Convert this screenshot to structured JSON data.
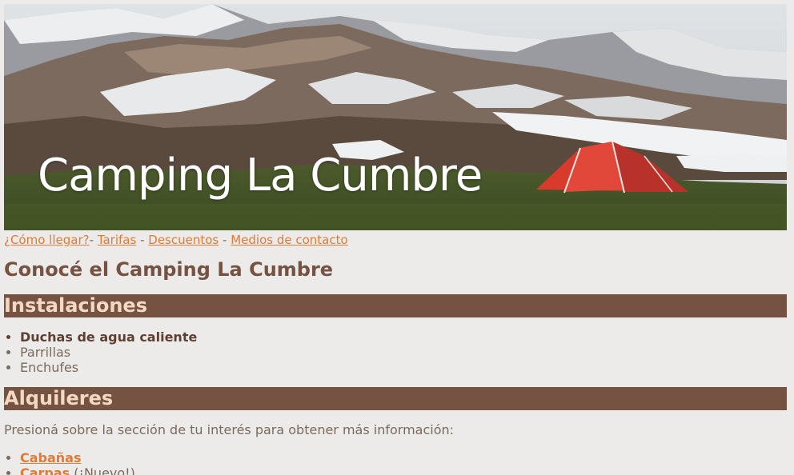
{
  "banner": {
    "title": "Camping La Cumbre",
    "image": "mountain-camping-tent-photo"
  },
  "nav": {
    "links": [
      {
        "label": "¿Cómo llegar?"
      },
      {
        "label": "Tarifas"
      },
      {
        "label": "Descuentos"
      },
      {
        "label": "Medios de contacto"
      }
    ],
    "separator": "-"
  },
  "main": {
    "title": "Conocé el Camping La Cumbre"
  },
  "instalaciones": {
    "heading": "Instalaciones",
    "items": [
      {
        "label": "Duchas de agua caliente"
      },
      {
        "label": "Parrillas"
      },
      {
        "label": "Enchufes"
      }
    ]
  },
  "alquileres": {
    "heading": "Alquileres",
    "intro": "Presioná sobre la sección de tu interés para obtener más información:",
    "items": [
      {
        "label": "Cabañas",
        "note": ""
      },
      {
        "label": "Carpas",
        "note": "(¡Nuevo!)"
      }
    ]
  },
  "colors": {
    "background": "#ecebe9",
    "accent": "#755242",
    "link": "#e07a34",
    "header_text": "#f4d9c2",
    "body_text": "#7a6a5e"
  }
}
